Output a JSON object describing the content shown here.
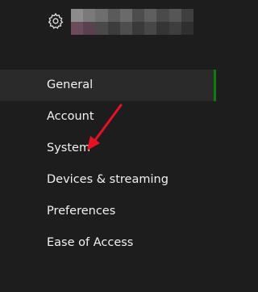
{
  "header": {
    "icon": "gear-icon",
    "profile_blurred": true
  },
  "nav": {
    "items": [
      {
        "label": "General",
        "selected": true
      },
      {
        "label": "Account",
        "selected": false
      },
      {
        "label": "System",
        "selected": false
      },
      {
        "label": "Devices & streaming",
        "selected": false
      },
      {
        "label": "Preferences",
        "selected": false
      },
      {
        "label": "Ease of Access",
        "selected": false
      }
    ]
  },
  "colors": {
    "background": "#1d1d1d",
    "selected_background": "#2a2a2a",
    "accent": "#107c10",
    "annotation_arrow": "#e81123",
    "text": "#f2f2f2"
  },
  "annotation": {
    "type": "arrow",
    "target": "System"
  }
}
